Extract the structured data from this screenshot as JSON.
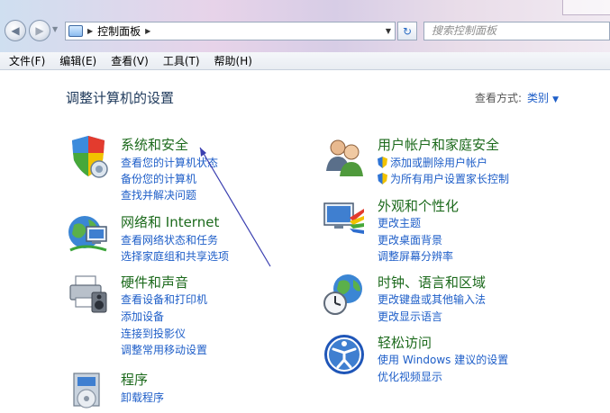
{
  "address": {
    "crumb": "控制面板"
  },
  "search": {
    "placeholder": "搜索控制面板"
  },
  "menu": [
    "文件(F)",
    "编辑(E)",
    "查看(V)",
    "工具(T)",
    "帮助(H)"
  ],
  "page": {
    "title": "调整计算机的设置",
    "view_by_label": "查看方式:",
    "view_by_value": "类别"
  },
  "categories": {
    "system": {
      "title": "系统和安全",
      "links": [
        "查看您的计算机状态",
        "备份您的计算机",
        "查找并解决问题"
      ]
    },
    "network": {
      "title": "网络和 Internet",
      "links": [
        "查看网络状态和任务",
        "选择家庭组和共享选项"
      ]
    },
    "hardware": {
      "title": "硬件和声音",
      "links": [
        "查看设备和打印机",
        "添加设备",
        "连接到投影仪",
        "调整常用移动设置"
      ]
    },
    "programs": {
      "title": "程序",
      "links": [
        "卸载程序"
      ]
    },
    "users": {
      "title": "用户帐户和家庭安全",
      "links": [
        "添加或删除用户帐户",
        "为所有用户设置家长控制"
      ]
    },
    "appearance": {
      "title": "外观和个性化",
      "links": [
        "更改主题",
        "更改桌面背景",
        "调整屏幕分辨率"
      ]
    },
    "clock": {
      "title": "时钟、语言和区域",
      "links": [
        "更改键盘或其他输入法",
        "更改显示语言"
      ]
    },
    "ease": {
      "title": "轻松访问",
      "links": [
        "使用 Windows 建议的设置",
        "优化视频显示"
      ]
    }
  },
  "colors": {
    "title_green": "#1c6a1c",
    "link_blue": "#1e5ec8",
    "heading_navy": "#1e395b"
  }
}
